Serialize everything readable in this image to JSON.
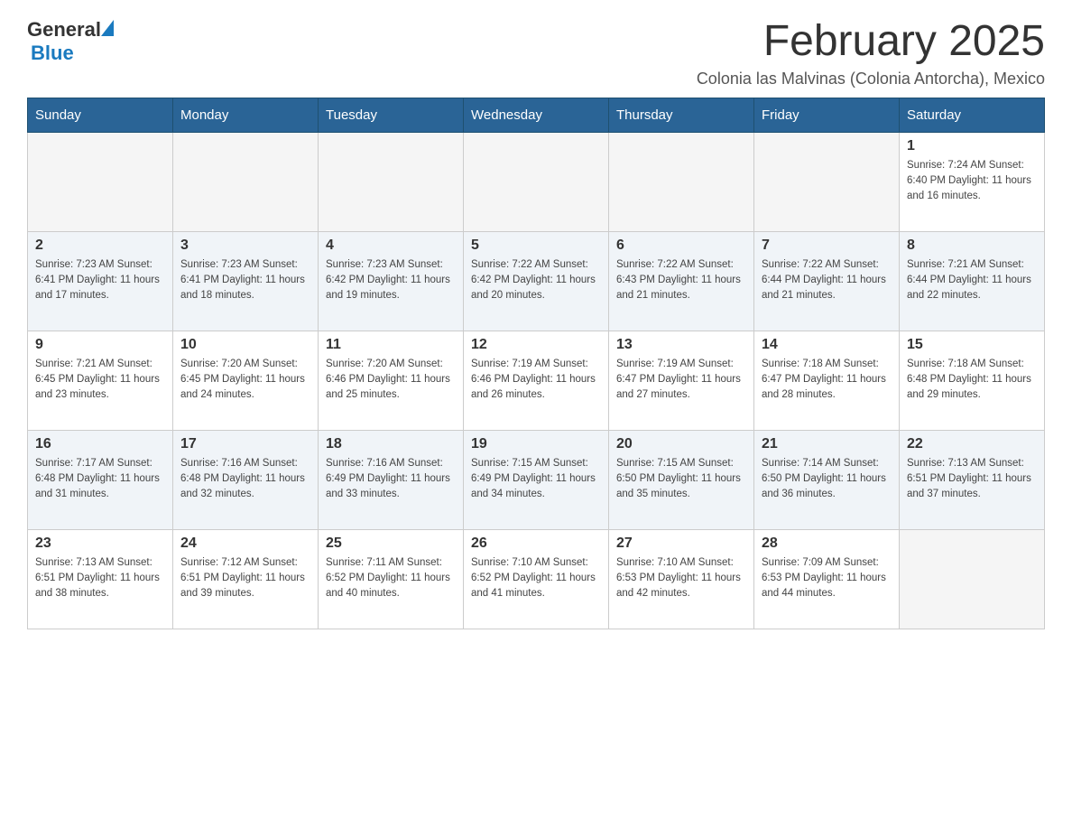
{
  "header": {
    "logo_general": "General",
    "logo_blue": "Blue",
    "title": "February 2025",
    "subtitle": "Colonia las Malvinas (Colonia Antorcha), Mexico"
  },
  "days_of_week": [
    "Sunday",
    "Monday",
    "Tuesday",
    "Wednesday",
    "Thursday",
    "Friday",
    "Saturday"
  ],
  "weeks": [
    {
      "days": [
        {
          "number": "",
          "info": ""
        },
        {
          "number": "",
          "info": ""
        },
        {
          "number": "",
          "info": ""
        },
        {
          "number": "",
          "info": ""
        },
        {
          "number": "",
          "info": ""
        },
        {
          "number": "",
          "info": ""
        },
        {
          "number": "1",
          "info": "Sunrise: 7:24 AM\nSunset: 6:40 PM\nDaylight: 11 hours and 16 minutes."
        }
      ]
    },
    {
      "days": [
        {
          "number": "2",
          "info": "Sunrise: 7:23 AM\nSunset: 6:41 PM\nDaylight: 11 hours and 17 minutes."
        },
        {
          "number": "3",
          "info": "Sunrise: 7:23 AM\nSunset: 6:41 PM\nDaylight: 11 hours and 18 minutes."
        },
        {
          "number": "4",
          "info": "Sunrise: 7:23 AM\nSunset: 6:42 PM\nDaylight: 11 hours and 19 minutes."
        },
        {
          "number": "5",
          "info": "Sunrise: 7:22 AM\nSunset: 6:42 PM\nDaylight: 11 hours and 20 minutes."
        },
        {
          "number": "6",
          "info": "Sunrise: 7:22 AM\nSunset: 6:43 PM\nDaylight: 11 hours and 21 minutes."
        },
        {
          "number": "7",
          "info": "Sunrise: 7:22 AM\nSunset: 6:44 PM\nDaylight: 11 hours and 21 minutes."
        },
        {
          "number": "8",
          "info": "Sunrise: 7:21 AM\nSunset: 6:44 PM\nDaylight: 11 hours and 22 minutes."
        }
      ]
    },
    {
      "days": [
        {
          "number": "9",
          "info": "Sunrise: 7:21 AM\nSunset: 6:45 PM\nDaylight: 11 hours and 23 minutes."
        },
        {
          "number": "10",
          "info": "Sunrise: 7:20 AM\nSunset: 6:45 PM\nDaylight: 11 hours and 24 minutes."
        },
        {
          "number": "11",
          "info": "Sunrise: 7:20 AM\nSunset: 6:46 PM\nDaylight: 11 hours and 25 minutes."
        },
        {
          "number": "12",
          "info": "Sunrise: 7:19 AM\nSunset: 6:46 PM\nDaylight: 11 hours and 26 minutes."
        },
        {
          "number": "13",
          "info": "Sunrise: 7:19 AM\nSunset: 6:47 PM\nDaylight: 11 hours and 27 minutes."
        },
        {
          "number": "14",
          "info": "Sunrise: 7:18 AM\nSunset: 6:47 PM\nDaylight: 11 hours and 28 minutes."
        },
        {
          "number": "15",
          "info": "Sunrise: 7:18 AM\nSunset: 6:48 PM\nDaylight: 11 hours and 29 minutes."
        }
      ]
    },
    {
      "days": [
        {
          "number": "16",
          "info": "Sunrise: 7:17 AM\nSunset: 6:48 PM\nDaylight: 11 hours and 31 minutes."
        },
        {
          "number": "17",
          "info": "Sunrise: 7:16 AM\nSunset: 6:48 PM\nDaylight: 11 hours and 32 minutes."
        },
        {
          "number": "18",
          "info": "Sunrise: 7:16 AM\nSunset: 6:49 PM\nDaylight: 11 hours and 33 minutes."
        },
        {
          "number": "19",
          "info": "Sunrise: 7:15 AM\nSunset: 6:49 PM\nDaylight: 11 hours and 34 minutes."
        },
        {
          "number": "20",
          "info": "Sunrise: 7:15 AM\nSunset: 6:50 PM\nDaylight: 11 hours and 35 minutes."
        },
        {
          "number": "21",
          "info": "Sunrise: 7:14 AM\nSunset: 6:50 PM\nDaylight: 11 hours and 36 minutes."
        },
        {
          "number": "22",
          "info": "Sunrise: 7:13 AM\nSunset: 6:51 PM\nDaylight: 11 hours and 37 minutes."
        }
      ]
    },
    {
      "days": [
        {
          "number": "23",
          "info": "Sunrise: 7:13 AM\nSunset: 6:51 PM\nDaylight: 11 hours and 38 minutes."
        },
        {
          "number": "24",
          "info": "Sunrise: 7:12 AM\nSunset: 6:51 PM\nDaylight: 11 hours and 39 minutes."
        },
        {
          "number": "25",
          "info": "Sunrise: 7:11 AM\nSunset: 6:52 PM\nDaylight: 11 hours and 40 minutes."
        },
        {
          "number": "26",
          "info": "Sunrise: 7:10 AM\nSunset: 6:52 PM\nDaylight: 11 hours and 41 minutes."
        },
        {
          "number": "27",
          "info": "Sunrise: 7:10 AM\nSunset: 6:53 PM\nDaylight: 11 hours and 42 minutes."
        },
        {
          "number": "28",
          "info": "Sunrise: 7:09 AM\nSunset: 6:53 PM\nDaylight: 11 hours and 44 minutes."
        },
        {
          "number": "",
          "info": ""
        }
      ]
    }
  ]
}
